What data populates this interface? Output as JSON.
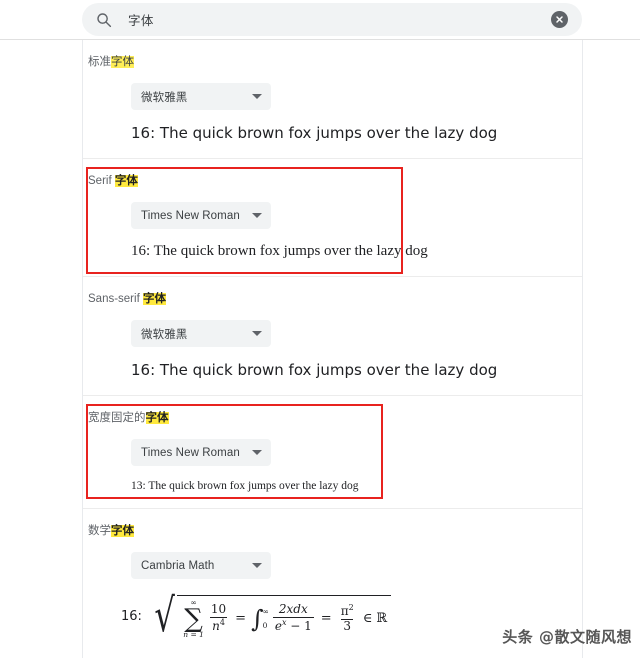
{
  "search": {
    "icon": "search-icon",
    "value": "字体",
    "clear_icon": "close-circle-icon"
  },
  "sections": [
    {
      "label_prefix": "标准",
      "label_highlight": "字体",
      "dropdown_value": "微软雅黑",
      "sample_size": "16",
      "sample_text": "16: The quick brown fox jumps over the lazy dog",
      "annotated": false
    },
    {
      "label_prefix": "Serif ",
      "label_highlight": "字体",
      "dropdown_value": "Times New Roman",
      "sample_size": "16",
      "sample_text": "16: The quick brown fox jumps over the lazy dog",
      "annotated": true
    },
    {
      "label_prefix": "Sans-serif ",
      "label_highlight": "字体",
      "dropdown_value": "微软雅黑",
      "sample_size": "16",
      "sample_text": "16: The quick brown fox jumps over the lazy dog",
      "annotated": false
    },
    {
      "label_prefix": "宽度固定的",
      "label_highlight": "字体",
      "dropdown_value": "Times New Roman",
      "sample_size": "13",
      "sample_text": "13: The quick brown fox jumps over the lazy dog",
      "annotated": true
    },
    {
      "label_prefix": "数学",
      "label_highlight": "字体",
      "dropdown_value": "Cambria Math",
      "sample_size": "16",
      "sample_text": "",
      "annotated": false
    }
  ],
  "math_sample": {
    "prefix": "16:",
    "sum_upper": "∞",
    "sum_glyph": "∑",
    "sum_lower": "n = 1",
    "frac1_num": "10",
    "frac1_den": "n",
    "frac1_den_exp": "4",
    "equals1": "=",
    "integral_glyph": "∫",
    "integral_upper": "∞",
    "integral_lower": "0",
    "frac2_num": "2xdx",
    "frac2_den": "e",
    "frac2_den_exp": "x",
    "frac2_den_rest": " − 1",
    "equals2": "=",
    "frac3_num": "π",
    "frac3_num_exp": "2",
    "frac3_den": "3",
    "member": "∈",
    "reals": "ℝ",
    "plain": "16: √( Σ[n=1..∞] 10/n⁴ = ∫[0..∞] 2xdx/(eˣ − 1) = π²/3 ∈ ℝ )"
  },
  "watermark": "头条 @散文随风想",
  "colors": {
    "highlight": "#ffee58",
    "annotation_red": "#e8231f",
    "control_bg": "#f1f3f4",
    "text": "#3c4043"
  }
}
